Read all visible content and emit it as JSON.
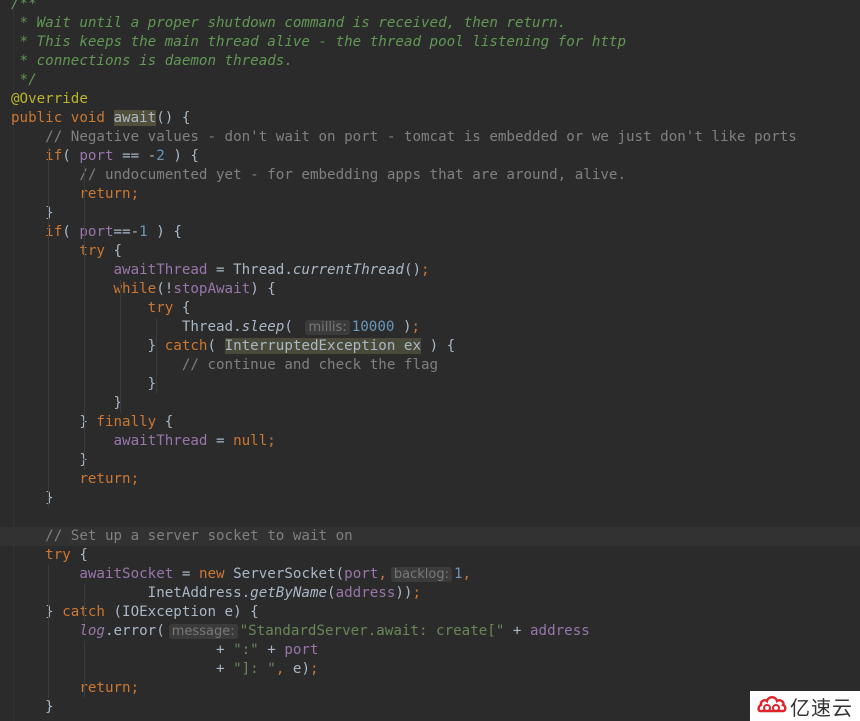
{
  "editor": {
    "theme_colors": {
      "background": "#2b2b2b",
      "current_line": "#323232",
      "doc_comment": "#629755",
      "line_comment": "#808080",
      "keyword": "#cc7832",
      "annotation": "#bbb529",
      "field": "#9876aa",
      "number": "#6897bb",
      "string": "#6a8759",
      "default": "#a9b7c6",
      "hint": "#787878"
    },
    "lines": [
      {
        "tokens": [
          {
            "c": "t-doc",
            "t": "/**"
          }
        ]
      },
      {
        "tokens": [
          {
            "c": "t-doc",
            "t": " * Wait until a proper shutdown command is received, then return."
          }
        ]
      },
      {
        "tokens": [
          {
            "c": "t-doc",
            "t": " * This keeps the main thread alive - the thread pool listening for http"
          }
        ]
      },
      {
        "tokens": [
          {
            "c": "t-doc",
            "t": " * connections is daemon threads."
          }
        ]
      },
      {
        "tokens": [
          {
            "c": "t-doc",
            "t": " */"
          }
        ]
      },
      {
        "tokens": [
          {
            "c": "t-ann",
            "t": "@Override"
          }
        ]
      },
      {
        "tokens": [
          {
            "c": "t-kw",
            "t": "public void "
          },
          {
            "c": "t-hl",
            "t": "await"
          },
          {
            "c": "t-plain",
            "t": "() {"
          }
        ]
      },
      {
        "tokens": [
          {
            "c": "t-plain",
            "t": "    "
          },
          {
            "c": "t-cmt",
            "t": "// Negative values - don't wait on port - tomcat is embedded or we just don't like ports"
          }
        ]
      },
      {
        "tokens": [
          {
            "c": "t-plain",
            "t": "    "
          },
          {
            "c": "t-kw",
            "t": "if"
          },
          {
            "c": "t-plain",
            "t": "( "
          },
          {
            "c": "t-fld",
            "t": "port"
          },
          {
            "c": "t-plain",
            "t": " == -"
          },
          {
            "c": "t-num",
            "t": "2"
          },
          {
            "c": "t-plain",
            "t": " ) {"
          }
        ]
      },
      {
        "tokens": [
          {
            "c": "t-plain",
            "t": "        "
          },
          {
            "c": "t-cmt",
            "t": "// undocumented yet - for embedding apps that are around, alive."
          }
        ]
      },
      {
        "tokens": [
          {
            "c": "t-plain",
            "t": "        "
          },
          {
            "c": "t-kw",
            "t": "return;"
          }
        ]
      },
      {
        "tokens": [
          {
            "c": "t-plain",
            "t": "    }"
          }
        ]
      },
      {
        "tokens": [
          {
            "c": "t-plain",
            "t": "    "
          },
          {
            "c": "t-kw",
            "t": "if"
          },
          {
            "c": "t-plain",
            "t": "( "
          },
          {
            "c": "t-fld",
            "t": "port"
          },
          {
            "c": "t-plain",
            "t": "==-"
          },
          {
            "c": "t-num",
            "t": "1"
          },
          {
            "c": "t-plain",
            "t": " ) {"
          }
        ]
      },
      {
        "tokens": [
          {
            "c": "t-plain",
            "t": "        "
          },
          {
            "c": "t-kw",
            "t": "try"
          },
          {
            "c": "t-plain",
            "t": " {"
          }
        ]
      },
      {
        "tokens": [
          {
            "c": "t-plain",
            "t": "            "
          },
          {
            "c": "t-fld",
            "t": "awaitThread"
          },
          {
            "c": "t-plain",
            "t": " = Thread."
          },
          {
            "c": "t-ital",
            "t": "currentThread"
          },
          {
            "c": "t-plain",
            "t": "()"
          },
          {
            "c": "t-kw",
            "t": ";"
          }
        ]
      },
      {
        "tokens": [
          {
            "c": "t-plain",
            "t": "            "
          },
          {
            "c": "t-kw",
            "t": "while"
          },
          {
            "c": "t-plain",
            "t": "(!"
          },
          {
            "c": "t-fld",
            "t": "stopAwait"
          },
          {
            "c": "t-plain",
            "t": ") {"
          }
        ]
      },
      {
        "tokens": [
          {
            "c": "t-plain",
            "t": "                "
          },
          {
            "c": "t-kw",
            "t": "try"
          },
          {
            "c": "t-plain",
            "t": " {"
          }
        ]
      },
      {
        "tokens": [
          {
            "c": "t-plain",
            "t": "                    Thread."
          },
          {
            "c": "t-ital",
            "t": "sleep"
          },
          {
            "c": "t-plain",
            "t": "( "
          },
          {
            "c": "hint",
            "t": "millis:"
          },
          {
            "c": "t-num",
            "t": "10000"
          },
          {
            "c": "t-plain",
            "t": " )"
          },
          {
            "c": "t-kw",
            "t": ";"
          }
        ]
      },
      {
        "tokens": [
          {
            "c": "t-plain",
            "t": "                } "
          },
          {
            "c": "t-kw",
            "t": "catch"
          },
          {
            "c": "t-plain",
            "t": "( "
          },
          {
            "c": "t-hl2",
            "t": "InterruptedException ex"
          },
          {
            "c": "t-plain",
            "t": " ) {"
          }
        ]
      },
      {
        "tokens": [
          {
            "c": "t-plain",
            "t": "                    "
          },
          {
            "c": "t-cmt",
            "t": "// continue and check the flag"
          }
        ]
      },
      {
        "tokens": [
          {
            "c": "t-plain",
            "t": "                }"
          }
        ]
      },
      {
        "tokens": [
          {
            "c": "t-plain",
            "t": "            }"
          }
        ]
      },
      {
        "tokens": [
          {
            "c": "t-plain",
            "t": "        } "
          },
          {
            "c": "t-kw",
            "t": "finally"
          },
          {
            "c": "t-plain",
            "t": " {"
          }
        ]
      },
      {
        "tokens": [
          {
            "c": "t-plain",
            "t": "            "
          },
          {
            "c": "t-fld",
            "t": "awaitThread"
          },
          {
            "c": "t-plain",
            "t": " = "
          },
          {
            "c": "t-kw",
            "t": "null;"
          }
        ]
      },
      {
        "tokens": [
          {
            "c": "t-plain",
            "t": "        }"
          }
        ]
      },
      {
        "tokens": [
          {
            "c": "t-plain",
            "t": "        "
          },
          {
            "c": "t-kw",
            "t": "return;"
          }
        ]
      },
      {
        "tokens": [
          {
            "c": "t-plain",
            "t": "    }"
          }
        ]
      },
      {
        "tokens": []
      },
      {
        "current": true,
        "tokens": [
          {
            "c": "t-plain",
            "t": "    "
          },
          {
            "c": "t-cmt",
            "t": "// Set up a server socket to wait on"
          }
        ]
      },
      {
        "tokens": [
          {
            "c": "t-plain",
            "t": "    "
          },
          {
            "c": "t-kw",
            "t": "try"
          },
          {
            "c": "t-plain",
            "t": " {"
          }
        ]
      },
      {
        "tokens": [
          {
            "c": "t-plain",
            "t": "        "
          },
          {
            "c": "t-fld",
            "t": "awaitSocket"
          },
          {
            "c": "t-plain",
            "t": " = "
          },
          {
            "c": "t-kw",
            "t": "new "
          },
          {
            "c": "t-plain",
            "t": "ServerSocket("
          },
          {
            "c": "t-fld",
            "t": "port"
          },
          {
            "c": "t-kw",
            "t": ","
          },
          {
            "c": "hint",
            "t": "backlog:"
          },
          {
            "c": "t-num",
            "t": "1"
          },
          {
            "c": "t-kw",
            "t": ","
          }
        ]
      },
      {
        "tokens": [
          {
            "c": "t-plain",
            "t": "                InetAddress."
          },
          {
            "c": "t-ital",
            "t": "getByName"
          },
          {
            "c": "t-plain",
            "t": "("
          },
          {
            "c": "t-fld",
            "t": "address"
          },
          {
            "c": "t-plain",
            "t": "))"
          },
          {
            "c": "t-kw",
            "t": ";"
          }
        ]
      },
      {
        "tokens": [
          {
            "c": "t-plain",
            "t": "    } "
          },
          {
            "c": "t-kw",
            "t": "catch"
          },
          {
            "c": "t-plain",
            "t": " (IOException e) {"
          }
        ]
      },
      {
        "tokens": [
          {
            "c": "t-plain",
            "t": "        "
          },
          {
            "c": "t-sfld",
            "t": "log"
          },
          {
            "c": "t-plain",
            "t": ".error("
          },
          {
            "c": "hint",
            "t": "message:"
          },
          {
            "c": "t-str",
            "t": "\"StandardServer.await: create[\""
          },
          {
            "c": "t-plain",
            "t": " + "
          },
          {
            "c": "t-fld",
            "t": "address"
          }
        ]
      },
      {
        "tokens": [
          {
            "c": "t-plain",
            "t": "                        + "
          },
          {
            "c": "t-str",
            "t": "\":\""
          },
          {
            "c": "t-plain",
            "t": " + "
          },
          {
            "c": "t-fld",
            "t": "port"
          }
        ]
      },
      {
        "tokens": [
          {
            "c": "t-plain",
            "t": "                        + "
          },
          {
            "c": "t-str",
            "t": "\"]: \""
          },
          {
            "c": "t-kw",
            "t": ","
          },
          {
            "c": "t-plain",
            "t": " e)"
          },
          {
            "c": "t-kw",
            "t": ";"
          }
        ]
      },
      {
        "tokens": [
          {
            "c": "t-plain",
            "t": "        "
          },
          {
            "c": "t-kw",
            "t": "return;"
          }
        ]
      },
      {
        "tokens": [
          {
            "c": "t-plain",
            "t": "    }"
          }
        ]
      }
    ]
  },
  "watermark": {
    "text": "亿速云",
    "icon": "cloud-logo-icon",
    "color": "#e0242b"
  }
}
